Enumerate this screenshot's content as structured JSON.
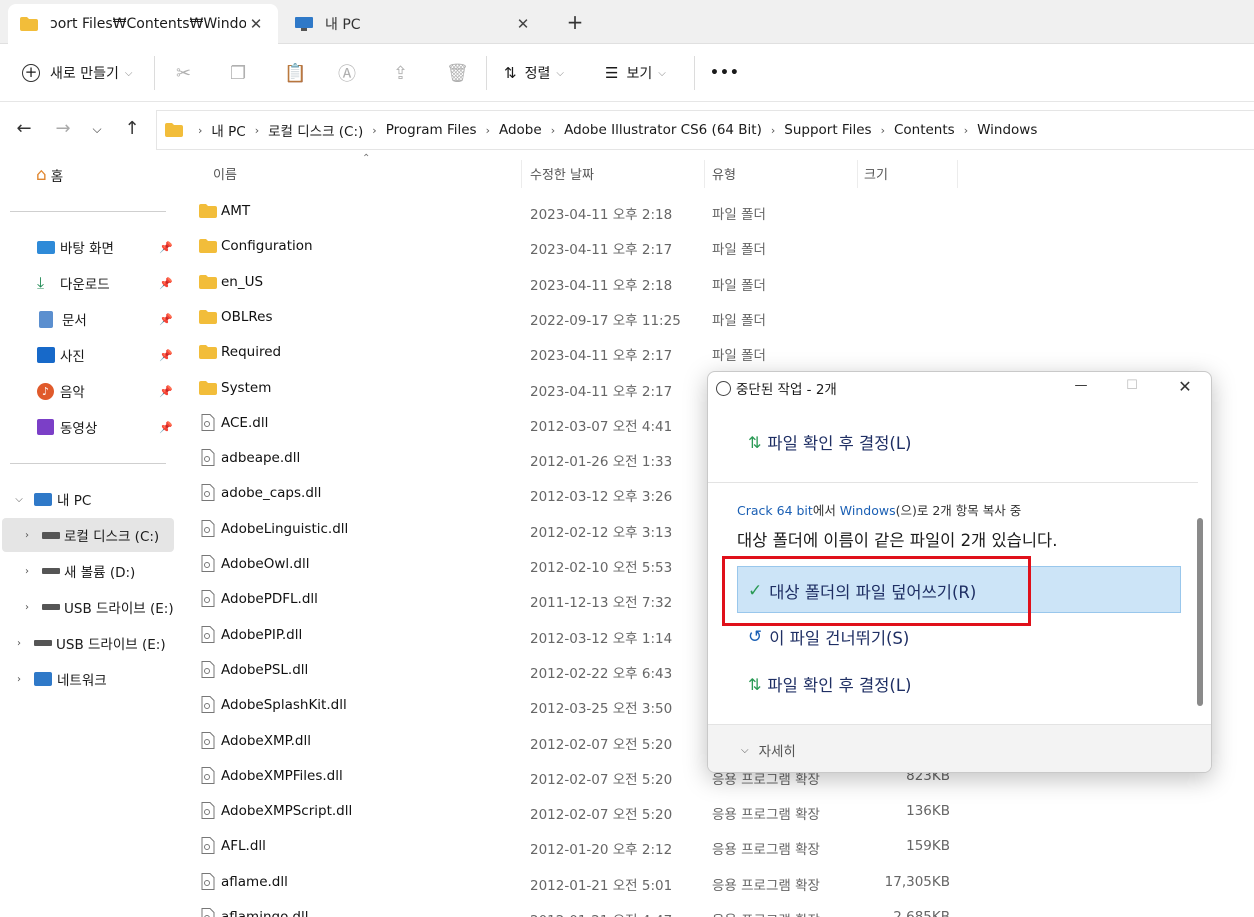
{
  "tabs": [
    {
      "label": "ɔort Files₩Contents₩Windows",
      "active": true
    },
    {
      "label": "내 PC",
      "active": false
    }
  ],
  "toolbar": {
    "new_label": "새로 만들기",
    "sort_label": "정렬",
    "view_label": "보기",
    "more_label": "•••"
  },
  "breadcrumb": [
    "내 PC",
    "로컬 디스크 (C:)",
    "Program Files",
    "Adobe",
    "Adobe Illustrator CS6 (64 Bit)",
    "Support Files",
    "Contents",
    "Windows"
  ],
  "sidebar": {
    "home": "홈",
    "quick": [
      {
        "label": "바탕 화면",
        "icon": "desktop-icon"
      },
      {
        "label": "다운로드",
        "icon": "download-icon"
      },
      {
        "label": "문서",
        "icon": "document-icon"
      },
      {
        "label": "사진",
        "icon": "pictures-icon"
      },
      {
        "label": "음악",
        "icon": "music-icon"
      },
      {
        "label": "동영상",
        "icon": "video-icon"
      }
    ],
    "this_pc": "내 PC",
    "drives": [
      "로컬 디스크 (C:)",
      "새 볼륨 (D:)",
      "USB 드라이브 (E:)"
    ],
    "usb": "USB 드라이브 (E:)",
    "network": "네트워크"
  },
  "columns": {
    "name": "이름",
    "date": "수정한 날짜",
    "type": "유형",
    "size": "크기"
  },
  "files": [
    {
      "name": "AMT",
      "date": "2023-04-11 오후 2:18",
      "type": "파일 폴더",
      "size": "",
      "folder": true
    },
    {
      "name": "Configuration",
      "date": "2023-04-11 오후 2:17",
      "type": "파일 폴더",
      "size": "",
      "folder": true
    },
    {
      "name": "en_US",
      "date": "2023-04-11 오후 2:18",
      "type": "파일 폴더",
      "size": "",
      "folder": true
    },
    {
      "name": "OBLRes",
      "date": "2022-09-17 오후 11:25",
      "type": "파일 폴더",
      "size": "",
      "folder": true
    },
    {
      "name": "Required",
      "date": "2023-04-11 오후 2:17",
      "type": "파일 폴더",
      "size": "",
      "folder": true
    },
    {
      "name": "System",
      "date": "2023-04-11 오후 2:17",
      "type": "",
      "size": "",
      "folder": true
    },
    {
      "name": "ACE.dll",
      "date": "2012-03-07 오전 4:41",
      "type": "",
      "size": "",
      "folder": false
    },
    {
      "name": "adbeape.dll",
      "date": "2012-01-26 오전 1:33",
      "type": "",
      "size": "",
      "folder": false
    },
    {
      "name": "adobe_caps.dll",
      "date": "2012-03-12 오후 3:26",
      "type": "",
      "size": "",
      "folder": false
    },
    {
      "name": "AdobeLinguistic.dll",
      "date": "2012-02-12 오후 3:13",
      "type": "",
      "size": "",
      "folder": false
    },
    {
      "name": "AdobeOwl.dll",
      "date": "2012-02-10 오전 5:53",
      "type": "",
      "size": "",
      "folder": false
    },
    {
      "name": "AdobePDFL.dll",
      "date": "2011-12-13 오전 7:32",
      "type": "",
      "size": "",
      "folder": false
    },
    {
      "name": "AdobePIP.dll",
      "date": "2012-03-12 오후 1:14",
      "type": "",
      "size": "",
      "folder": false
    },
    {
      "name": "AdobePSL.dll",
      "date": "2012-02-22 오후 6:43",
      "type": "",
      "size": "",
      "folder": false
    },
    {
      "name": "AdobeSplashKit.dll",
      "date": "2012-03-25 오전 3:50",
      "type": "",
      "size": "",
      "folder": false
    },
    {
      "name": "AdobeXMP.dll",
      "date": "2012-02-07 오전 5:20",
      "type": "",
      "size": "",
      "folder": false
    },
    {
      "name": "AdobeXMPFiles.dll",
      "date": "2012-02-07 오전 5:20",
      "type": "응용 프로그램 확장",
      "size": "823KB",
      "folder": false
    },
    {
      "name": "AdobeXMPScript.dll",
      "date": "2012-02-07 오전 5:20",
      "type": "응용 프로그램 확장",
      "size": "136KB",
      "folder": false
    },
    {
      "name": "AFL.dll",
      "date": "2012-01-20 오후 2:12",
      "type": "응용 프로그램 확장",
      "size": "159KB",
      "folder": false
    },
    {
      "name": "aflame.dll",
      "date": "2012-01-21 오전 5:01",
      "type": "응용 프로그램 확장",
      "size": "17,305KB",
      "folder": false
    },
    {
      "name": "aflamingo.dll",
      "date": "2012-01-21 오전 4:47",
      "type": "응용 프로그램 확장",
      "size": "2,685KB",
      "folder": false
    }
  ],
  "dialog": {
    "title": "중단된 작업 - 2개",
    "top_option": "파일 확인 후 결정(L)",
    "copy_source": "Crack 64 bit",
    "copy_mid1": "에서 ",
    "copy_dest": "Windows",
    "copy_mid2": "(으)로 2개 항목 복사 중",
    "heading": "대상 폴더에 이름이 같은 파일이 2개 있습니다.",
    "option_replace": "대상 폴더의 파일 덮어쓰기(R)",
    "option_skip": "이 파일 건너뛰기(S)",
    "option_decide": "파일 확인 후 결정(L)",
    "details": "자세히"
  }
}
